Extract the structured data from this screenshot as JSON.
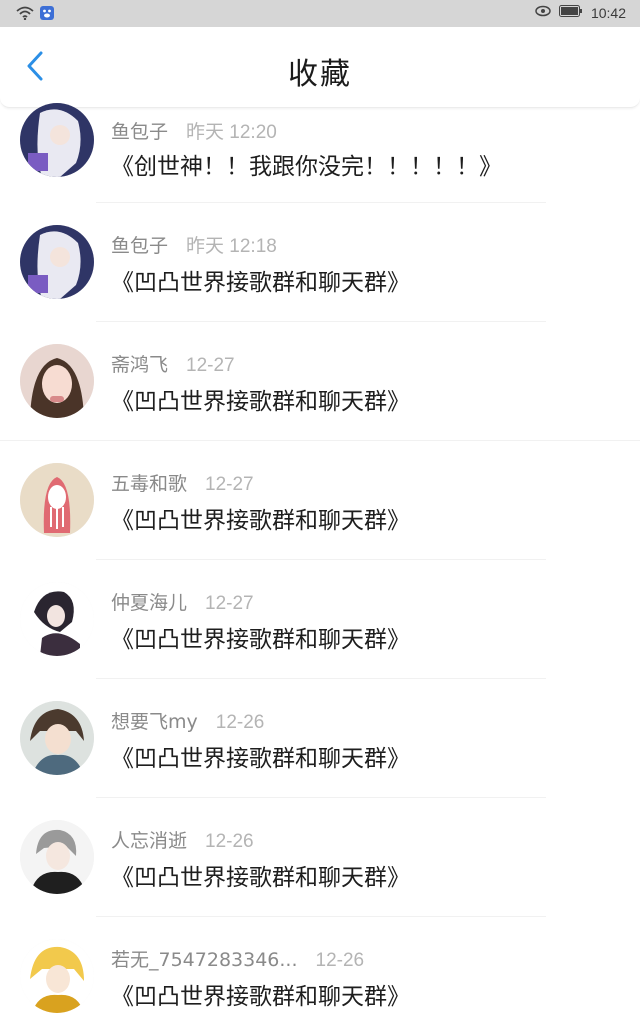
{
  "status_bar": {
    "time": "10:42"
  },
  "header": {
    "title": "收藏"
  },
  "items": [
    {
      "sender": "鱼包子",
      "date": "昨天 12:20",
      "message": "《创世神！！我跟你没完！！！！！》"
    },
    {
      "sender": "鱼包子",
      "date": "昨天 12:18",
      "message": "《凹凸世界接歌群和聊天群》"
    },
    {
      "sender": "斋鸿飞",
      "date": "12-27",
      "message": "《凹凸世界接歌群和聊天群》"
    },
    {
      "sender": "五毒和歌",
      "date": "12-27",
      "message": "《凹凸世界接歌群和聊天群》"
    },
    {
      "sender": "仲夏海儿",
      "date": "12-27",
      "message": "《凹凸世界接歌群和聊天群》"
    },
    {
      "sender": "想要飞my",
      "date": "12-26",
      "message": "《凹凸世界接歌群和聊天群》"
    },
    {
      "sender": "人忘消逝",
      "date": "12-26",
      "message": "《凹凸世界接歌群和聊天群》"
    },
    {
      "sender": "若无_7547283346...",
      "date": "12-26",
      "message": "《凹凸世界接歌群和聊天群》"
    }
  ],
  "colors": {
    "accent": "#2b8fe6",
    "status_bar": "#d6d6d6"
  },
  "icons": [
    "wifi-icon",
    "baidu-icon",
    "eye-icon",
    "battery-icon",
    "back-arrow-icon"
  ]
}
